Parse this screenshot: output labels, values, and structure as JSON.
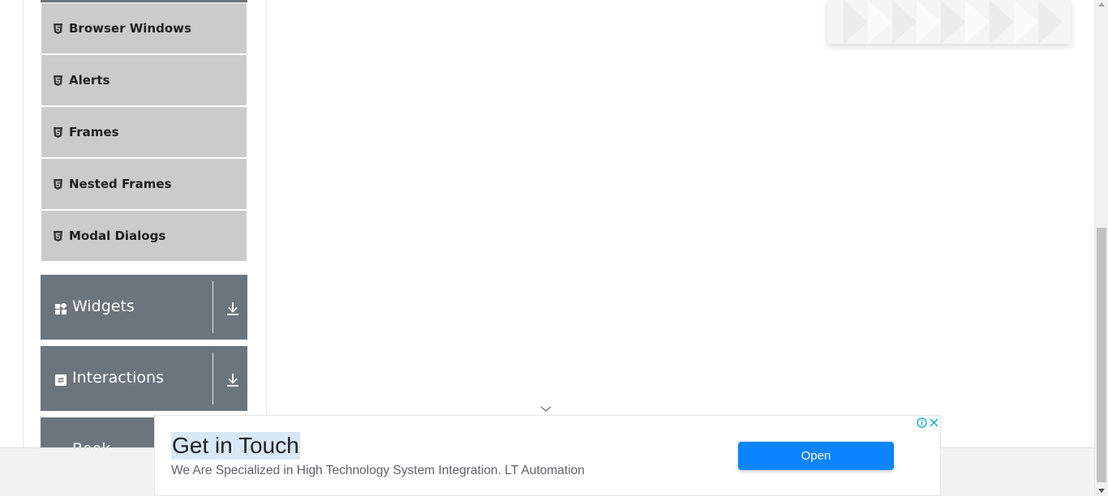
{
  "sidebar": {
    "sub_items": [
      {
        "label": "Browser Windows",
        "icon": "html5-icon"
      },
      {
        "label": "Alerts",
        "icon": "html5-icon"
      },
      {
        "label": "Frames",
        "icon": "html5-icon"
      },
      {
        "label": "Nested Frames",
        "icon": "html5-icon"
      },
      {
        "label": "Modal Dialogs",
        "icon": "html5-icon"
      }
    ],
    "groups": [
      {
        "label": "Widgets",
        "icon": "widgets-icon"
      },
      {
        "label": "Interactions",
        "icon": "interactions-icon"
      },
      {
        "label": "Book Store",
        "icon": "book-store-icon"
      }
    ]
  },
  "ad": {
    "title": "Get in Touch",
    "description": "We Are Specialized in High Technology System Integration. LT Automation",
    "button_label": "Open",
    "accent_color": "#0a84ff"
  },
  "colors": {
    "group_bg": "#6c757d",
    "sub_item_bg": "#cbcbcb"
  }
}
